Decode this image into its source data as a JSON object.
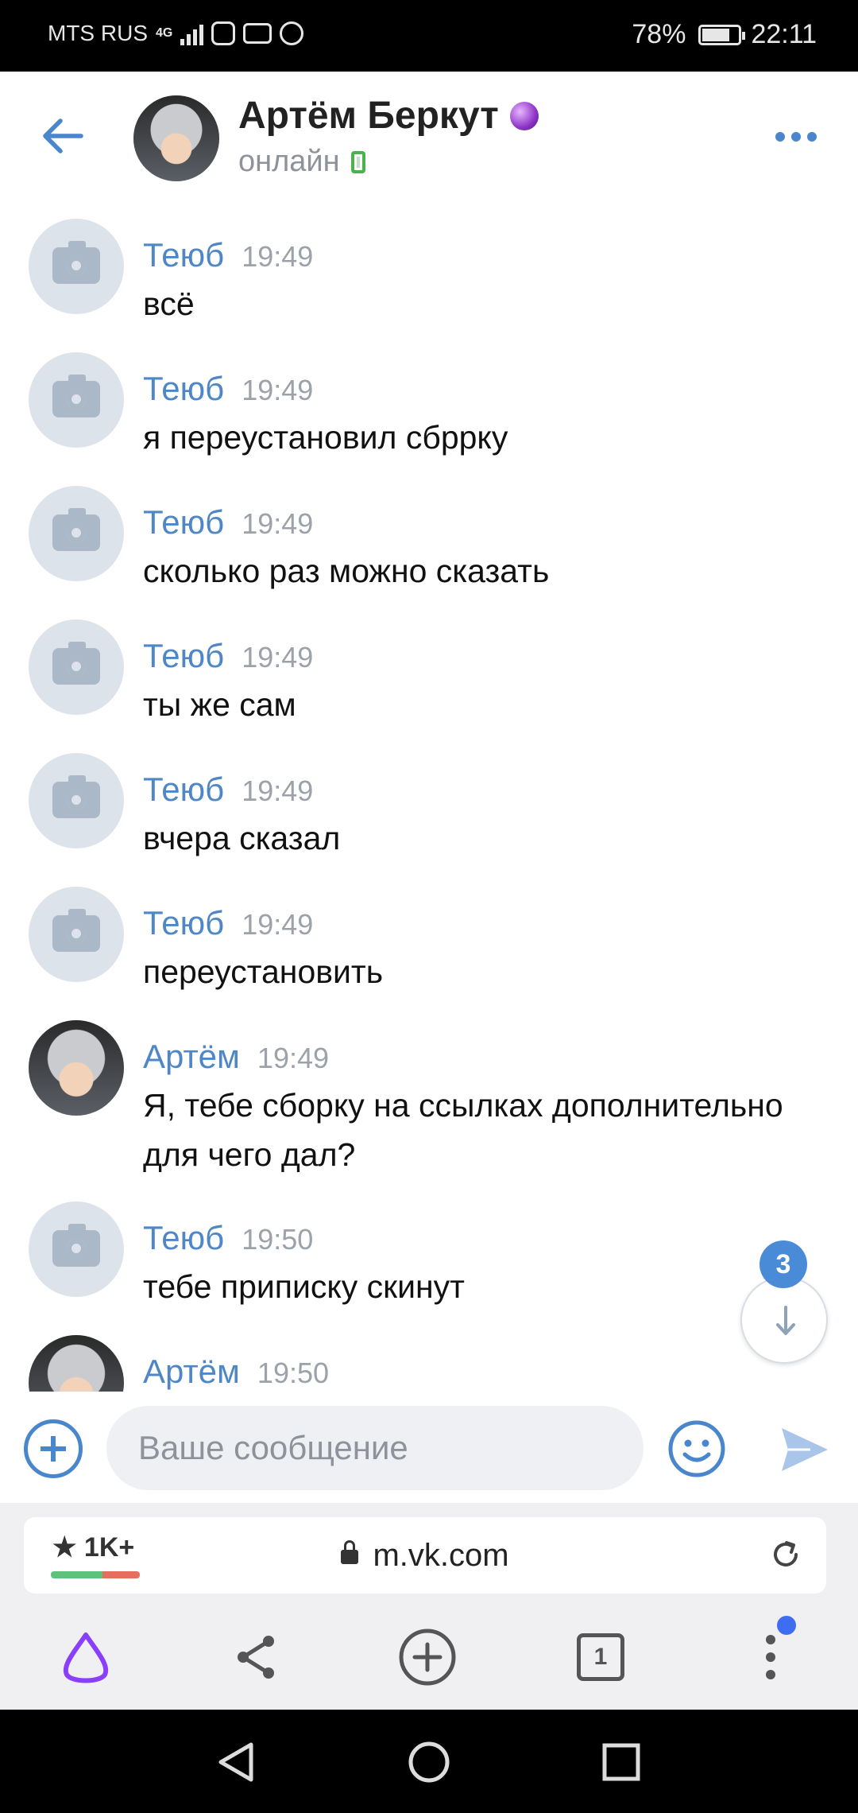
{
  "status_bar": {
    "carrier": "MTS RUS",
    "network": "4G",
    "battery": "78%",
    "battery_level": 0.78,
    "time": "22:11"
  },
  "header": {
    "contact_name": "Артём Беркут",
    "status": "онлайн"
  },
  "messages": [
    {
      "author": "Теюб",
      "time": "19:49",
      "text": "всё",
      "avatar": "camera"
    },
    {
      "author": "Теюб",
      "time": "19:49",
      "text": "я переустановил сбррку",
      "avatar": "camera"
    },
    {
      "author": "Теюб",
      "time": "19:49",
      "text": "сколько раз можно сказать",
      "avatar": "camera"
    },
    {
      "author": "Теюб",
      "time": "19:49",
      "text": "ты же сам",
      "avatar": "camera"
    },
    {
      "author": "Теюб",
      "time": "19:49",
      "text": "вчера сказал",
      "avatar": "camera"
    },
    {
      "author": "Теюб",
      "time": "19:49",
      "text": "переустановить",
      "avatar": "camera"
    },
    {
      "author": "Артём",
      "time": "19:49",
      "text": "Я, тебе сборку на ссылках дополнительно для чего дал?",
      "avatar": "photo"
    },
    {
      "author": "Теюб",
      "time": "19:50",
      "text": "тебе приписку скинут",
      "avatar": "camera"
    },
    {
      "author": "Артём",
      "time": "19:50",
      "text": "",
      "avatar": "photo"
    }
  ],
  "unread_badge": "3",
  "composer": {
    "placeholder": "Ваше сообщение"
  },
  "browser": {
    "rating": "★ 1K+",
    "url": "m.vk.com",
    "tabs_count": "1"
  },
  "colors": {
    "accent": "#4986cc",
    "author": "#4f87c6",
    "online": "#4bb34b",
    "badge": "#4a8bd8"
  }
}
